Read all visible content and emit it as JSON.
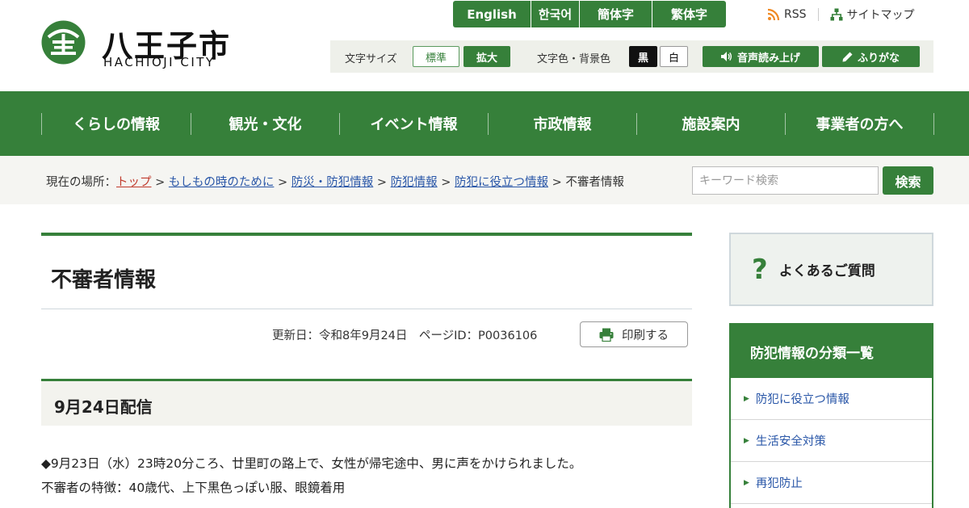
{
  "logo": {
    "jp": "八王子市",
    "en": "HACHIOJI CITY",
    "mark_char": "王"
  },
  "languages": [
    "English",
    "한국어",
    "簡体字",
    "繁体字"
  ],
  "util_links": {
    "rss": "RSS",
    "sitemap": "サイトマップ"
  },
  "toolbar": {
    "font_size_label": "文字サイズ",
    "standard": "標準",
    "enlarge": "拡大",
    "color_label": "文字色・背景色",
    "black": "黒",
    "white": "白",
    "read_aloud": "音声読み上げ",
    "furigana": "ふりがな"
  },
  "nav": [
    "くらしの情報",
    "観光・文化",
    "イベント情報",
    "市政情報",
    "施設案内",
    "事業者の方へ"
  ],
  "breadcrumb": {
    "prefix": "現在の場所：",
    "items": [
      "トップ",
      "もしもの時のために",
      "防災・防犯情報",
      "防犯情報",
      "防犯に役立つ情報"
    ],
    "separator": " > ",
    "current": "不審者情報"
  },
  "search": {
    "placeholder": "キーワード検索",
    "button": "検索"
  },
  "page": {
    "title": "不審者情報",
    "meta": "更新日：令和8年9月24日　ページID：P0036106",
    "print": "印刷する"
  },
  "section": {
    "title": "9月24日配信",
    "line1": "◆9月23日（水）23時20分ころ、廿里町の路上で、女性が帰宅途中、男に声をかけられました。",
    "line2": "不審者の特徴：40歳代、上下黒色っぽい服、眼鏡着用"
  },
  "sidebar": {
    "faq": "よくあるご質問",
    "faq_mark": "?",
    "menu_title": "防犯情報の分類一覧",
    "items": [
      "防犯に役立つ情報",
      "生活安全対策",
      "再犯防止"
    ]
  },
  "colors": {
    "brand_green": "#36803a",
    "link_blue": "#2a57a8",
    "top_link_red": "#c0392b"
  },
  "icons": [
    "rss-icon",
    "sitemap-icon",
    "speaker-icon",
    "pen-icon",
    "printer-icon",
    "chevron-right-icon"
  ]
}
